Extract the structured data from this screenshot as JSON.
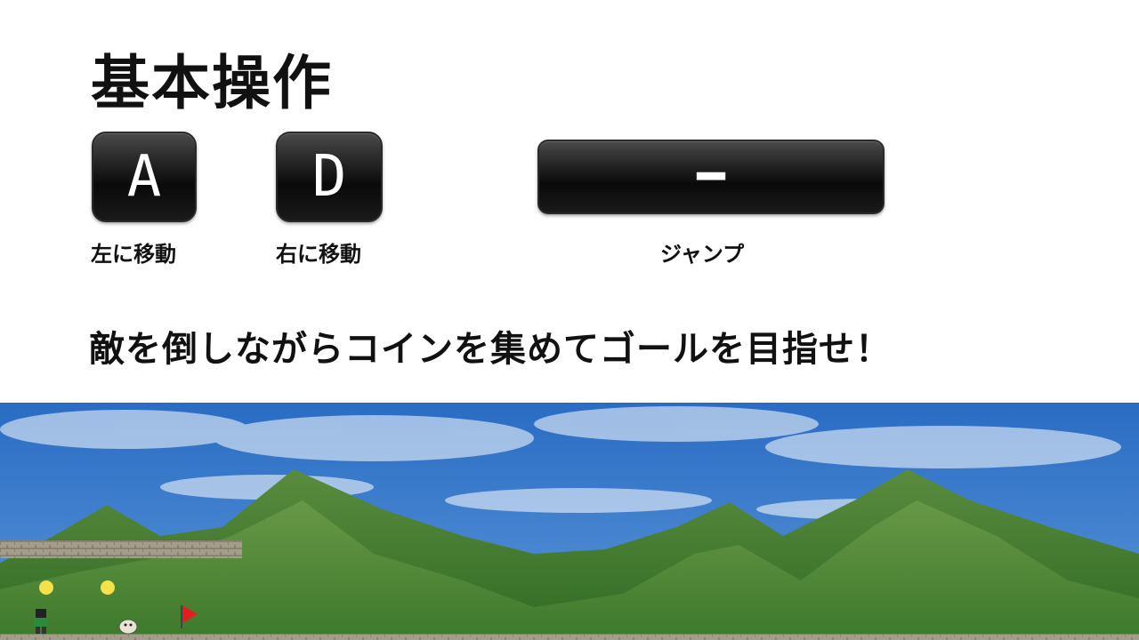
{
  "title": "基本操作",
  "controls": [
    {
      "key": "A",
      "label": "左に移動"
    },
    {
      "key": "D",
      "label": "右に移動"
    },
    {
      "key": "━",
      "label": "ジャンプ"
    }
  ],
  "instruction": "敵を倒しながらコインを集めてゴールを目指せ！",
  "game": {
    "sky_color": "#2f73c9",
    "mountain_color": "#4c8a36",
    "platform_color": "#a09a8a",
    "coin_color": "#f5e14a",
    "flag_color": "#e02020"
  }
}
